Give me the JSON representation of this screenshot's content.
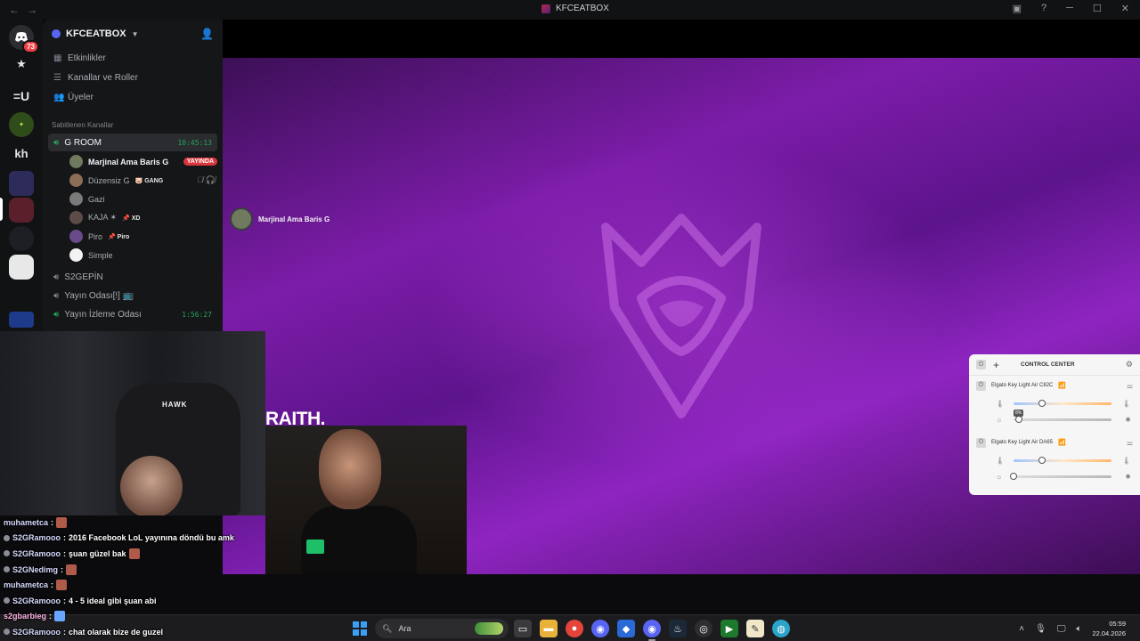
{
  "window": {
    "title": "KFCEATBOX",
    "back_glyph": "←",
    "forward_glyph": "→",
    "minimize_glyph": "─",
    "maximize_glyph": "☐",
    "close_glyph": "✕"
  },
  "rail": {
    "home_badge": "73",
    "kh_label": "kh",
    "su_label": "=U"
  },
  "server": {
    "name": "KFCEATBOX",
    "menu": [
      {
        "label": "Etkinlikler",
        "icon": "calendar-icon"
      },
      {
        "label": "Kanallar ve Roller",
        "icon": "channels-icon"
      },
      {
        "label": "Üyeler",
        "icon": "members-icon"
      }
    ],
    "pinned_section": "Sabitlenen Kanallar",
    "channels": [
      {
        "name": "G ROOM",
        "time": "10:45:13"
      },
      {
        "name": "S2GEPİN"
      },
      {
        "name": "Yayın Odası[!] 📺"
      },
      {
        "name": "Yayın İzleme Odası",
        "time": "1:56:27"
      }
    ],
    "voice_users": [
      {
        "name": "Marjinal Ama Baris G",
        "badge": "YAYINDA"
      },
      {
        "name": "Düzensiz G",
        "tag": "🐷 GANG"
      },
      {
        "name": "Gazi"
      },
      {
        "name": "KAJA ✶",
        "tag": "📌 XD"
      },
      {
        "name": "Piro",
        "tag": "📌 Piro"
      },
      {
        "name": "Simple"
      }
    ]
  },
  "stream": {
    "streamer_name": "Marjinal Ama Baris G",
    "overlay_text": "RAITH."
  },
  "control_center": {
    "title": "CONTROL CENTER",
    "devices": [
      {
        "name": "Elgato Key Light Air C82C",
        "tooltip": "8%",
        "temp": 0.25,
        "brightness": 0.08
      },
      {
        "name": "Elgato Key Light Air DA65",
        "temp": 0.25,
        "brightness": 0.0
      }
    ]
  },
  "chat": [
    {
      "user": "muhametca",
      "text": "",
      "emote": true
    },
    {
      "user": "S2GRamooo",
      "text": "2016 Facebook LoL yayınına döndü bu amk"
    },
    {
      "user": "S2GRamooo",
      "text": "şuan güzel bak"
    },
    {
      "user": "S2GNedimg",
      "text": "",
      "emote": true
    },
    {
      "user": "muhametca",
      "text": "",
      "emote": true
    },
    {
      "user": "S2GRamooo",
      "text": "4 - 5 ideal gibi şuan abi"
    },
    {
      "user": "s2gbarbieg",
      "text": "",
      "emote": true
    },
    {
      "user": "S2GRamooo",
      "text": "chat olarak bize de guzel"
    }
  ],
  "taskbar": {
    "search_placeholder": "Ara",
    "clock_time": "05:59",
    "clock_date": "22.04.2026"
  },
  "colors": {
    "accent": "#5865f2",
    "live_red": "#da373c",
    "voice_green": "#23a55a",
    "stream_purple": "#7b1aa8"
  }
}
